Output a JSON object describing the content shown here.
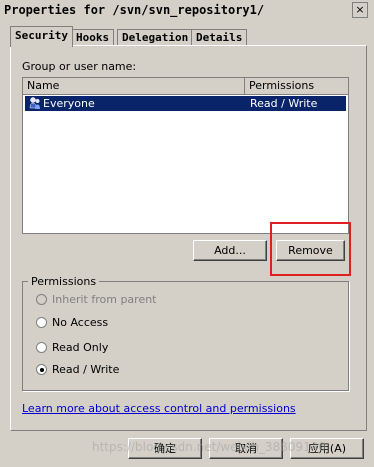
{
  "window": {
    "title": "Properties for /svn/svn_repository1/",
    "close_label": "×"
  },
  "tabs": [
    {
      "label": "Security",
      "active": true
    },
    {
      "label": "Hooks",
      "active": false
    },
    {
      "label": "Delegation",
      "active": false
    },
    {
      "label": "Details",
      "active": false
    }
  ],
  "security": {
    "group_label": "Group or user name:",
    "columns": {
      "name": "Name",
      "permissions": "Permissions"
    },
    "rows": [
      {
        "name": "Everyone",
        "permissions": "Read / Write",
        "selected": true
      }
    ],
    "add_label": "Add...",
    "remove_label": "Remove"
  },
  "permissions": {
    "legend": "Permissions",
    "options": [
      {
        "label": "Inherit from parent",
        "enabled": false,
        "checked": false
      },
      {
        "label": "No Access",
        "enabled": true,
        "checked": false
      },
      {
        "label": "Read Only",
        "enabled": true,
        "checked": false
      },
      {
        "label": "Read / Write",
        "enabled": true,
        "checked": true
      }
    ]
  },
  "link_text": "Learn more about access control and permissions",
  "footer": {
    "ok_label": "确定",
    "cancel_label": "取消",
    "apply_label": "应用(A)"
  },
  "watermark": "https://blog.csdn.net/weixin_38809140",
  "colors": {
    "selection": "#0a246a",
    "highlight_box": "#e02020",
    "link": "#0000cc"
  }
}
